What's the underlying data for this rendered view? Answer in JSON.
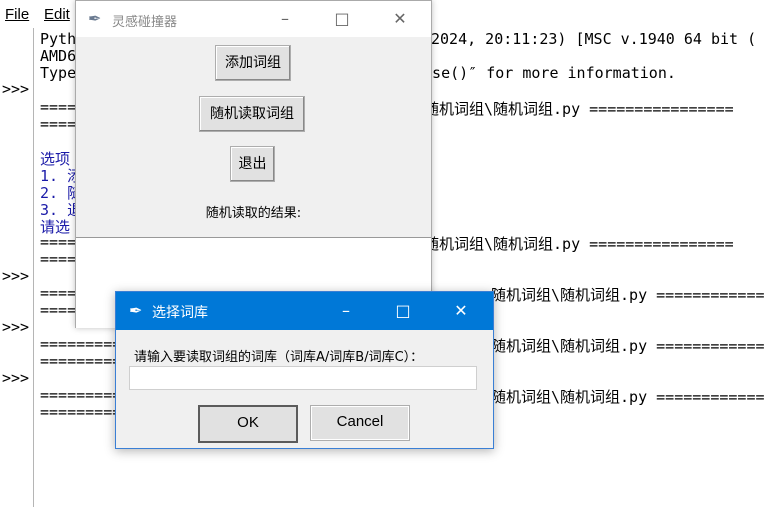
{
  "idle": {
    "menu": [
      "File",
      "Edit"
    ],
    "prompts": [
      ">>>",
      ">>>",
      ">>>",
      ">>>"
    ],
    "lines": [
      {
        "text": "Pyth",
        "blue": false
      },
      {
        "text": "AMD6",
        "blue": false
      },
      {
        "text": "Type",
        "blue": false
      },
      {
        "text": "====",
        "blue": false
      },
      {
        "text": "====",
        "blue": false
      },
      {
        "text": "选项",
        "blue": true
      },
      {
        "text": "1. 添",
        "blue": true
      },
      {
        "text": "2. 随",
        "blue": true
      },
      {
        "text": "3. 退",
        "blue": true
      },
      {
        "text": "请选",
        "blue": true
      },
      {
        "text": "====",
        "blue": false
      },
      {
        "text": "====",
        "blue": false
      },
      {
        "text": "====",
        "blue": false
      },
      {
        "text": "====",
        "blue": false
      },
      {
        "text": "=========",
        "blue": false
      },
      {
        "text": "=========",
        "blue": false
      },
      {
        "text": "=========",
        "blue": false
      },
      {
        "text": "=========",
        "blue": false
      }
    ],
    "right_lines": [
      "2024, 20:11:23) [MSC v.1940 64 bit (",
      "ense()″ for more information.",
      "随机词组\\随机词组.py ================",
      "随机词组\\随机词组.py ================",
      "随机词组\\随机词组.py ================",
      "随机词组\\随机词组.py ================",
      "随机词组\\随机词组.py ================"
    ]
  },
  "app": {
    "title": "灵感碰撞器",
    "add_button": "添加词组",
    "random_button": "随机读取词组",
    "exit_button": "退出",
    "result_label": "随机读取的结果:"
  },
  "dialog": {
    "title": "选择词库",
    "prompt": "请输入要读取词组的词库（词库A/词库B/词库C）：",
    "input_value": "",
    "ok": "OK",
    "cancel": "Cancel"
  }
}
